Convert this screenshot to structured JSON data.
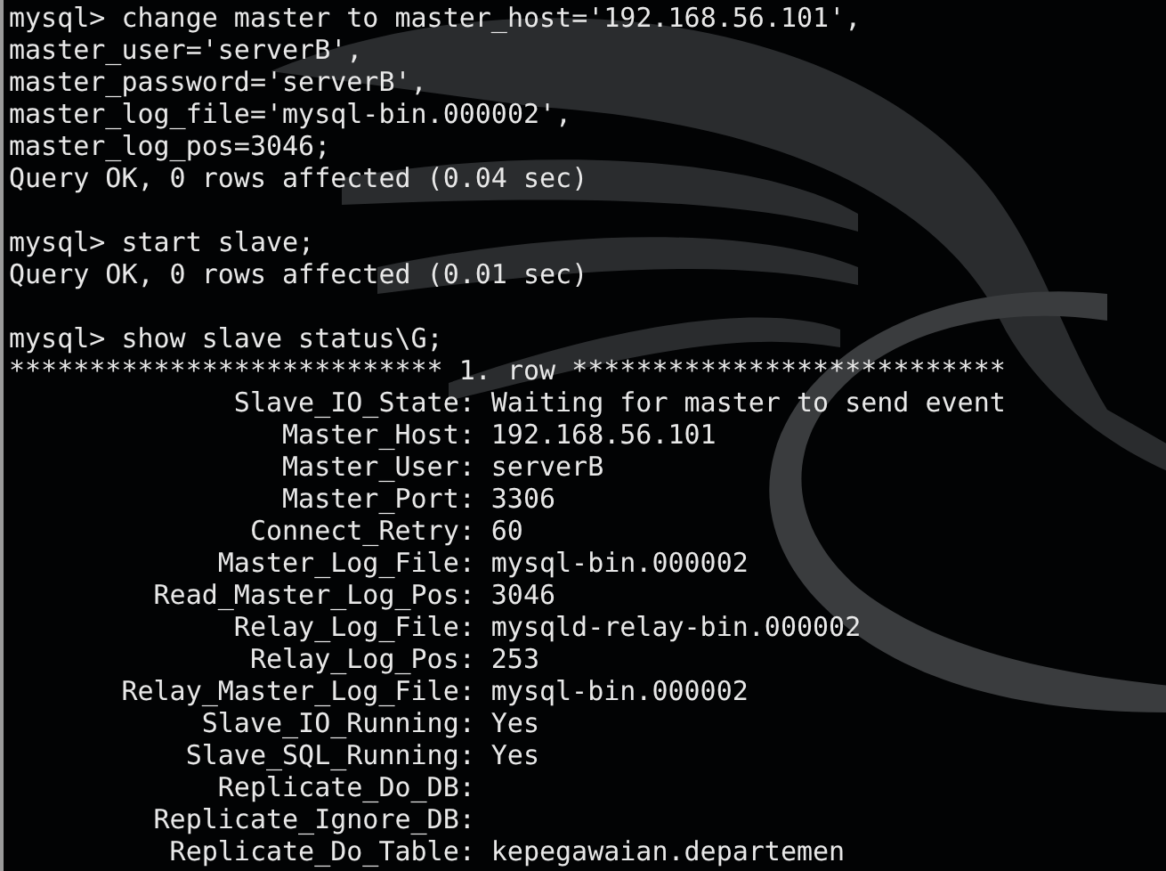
{
  "sections": [
    {
      "lines": [
        {
          "kind": "text",
          "text": "mysql> change master to master_host='192.168.56.101',"
        },
        {
          "kind": "text",
          "text": "master_user='serverB',"
        },
        {
          "kind": "text",
          "text": "master_password='serverB',"
        },
        {
          "kind": "text",
          "text": "master_log_file='mysql-bin.000002',"
        },
        {
          "kind": "text",
          "text": "master_log_pos=3046;"
        },
        {
          "kind": "text",
          "text": "Query OK, 0 rows affected (0.04 sec)"
        }
      ]
    },
    {
      "lines": [
        {
          "kind": "text",
          "text": "mysql> start slave;"
        },
        {
          "kind": "text",
          "text": "Query OK, 0 rows affected (0.01 sec)"
        }
      ]
    },
    {
      "lines": [
        {
          "kind": "text",
          "text": "mysql> show slave status\\G;"
        },
        {
          "kind": "text",
          "text": "*************************** 1. row ***************************"
        },
        {
          "kind": "field",
          "label": "Slave_IO_State:",
          "value": "Waiting for master to send event"
        },
        {
          "kind": "field",
          "label": "Master_Host:",
          "value": "192.168.56.101"
        },
        {
          "kind": "field",
          "label": "Master_User:",
          "value": "serverB"
        },
        {
          "kind": "field",
          "label": "Master_Port:",
          "value": "3306"
        },
        {
          "kind": "field",
          "label": "Connect_Retry:",
          "value": "60"
        },
        {
          "kind": "field",
          "label": "Master_Log_File:",
          "value": "mysql-bin.000002"
        },
        {
          "kind": "field",
          "label": "Read_Master_Log_Pos:",
          "value": "3046"
        },
        {
          "kind": "field",
          "label": "Relay_Log_File:",
          "value": "mysqld-relay-bin.000002"
        },
        {
          "kind": "field",
          "label": "Relay_Log_Pos:",
          "value": "253"
        },
        {
          "kind": "field",
          "label": "Relay_Master_Log_File:",
          "value": "mysql-bin.000002"
        },
        {
          "kind": "field",
          "label": "Slave_IO_Running:",
          "value": "Yes"
        },
        {
          "kind": "field",
          "label": "Slave_SQL_Running:",
          "value": "Yes"
        },
        {
          "kind": "field",
          "label": "Replicate_Do_DB:"
        },
        {
          "kind": "field",
          "label": "Replicate_Ignore_DB:"
        },
        {
          "kind": "field",
          "label": "Replicate_Do_Table:",
          "value": "kepegawaian.departemen"
        }
      ]
    }
  ]
}
